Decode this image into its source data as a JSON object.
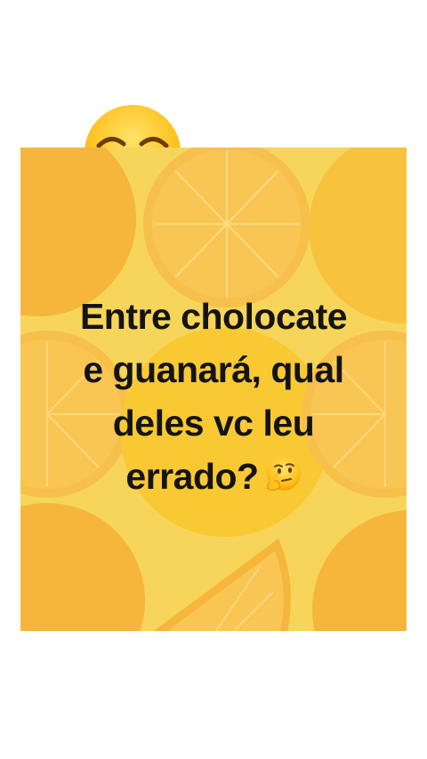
{
  "post": {
    "caption_lines": [
      "Entre cholocate",
      "e guanará, qual",
      "deles vc leu",
      "errado?"
    ],
    "trailing_emoji": "thinking-face",
    "peeking_emoji": "smiling-face"
  },
  "colors": {
    "page_background": "#ffffff",
    "card_background": "#f7d55a",
    "orange_slice": "#f6b53b",
    "orange_slice_light": "#f9c64e",
    "text": "#141414"
  }
}
